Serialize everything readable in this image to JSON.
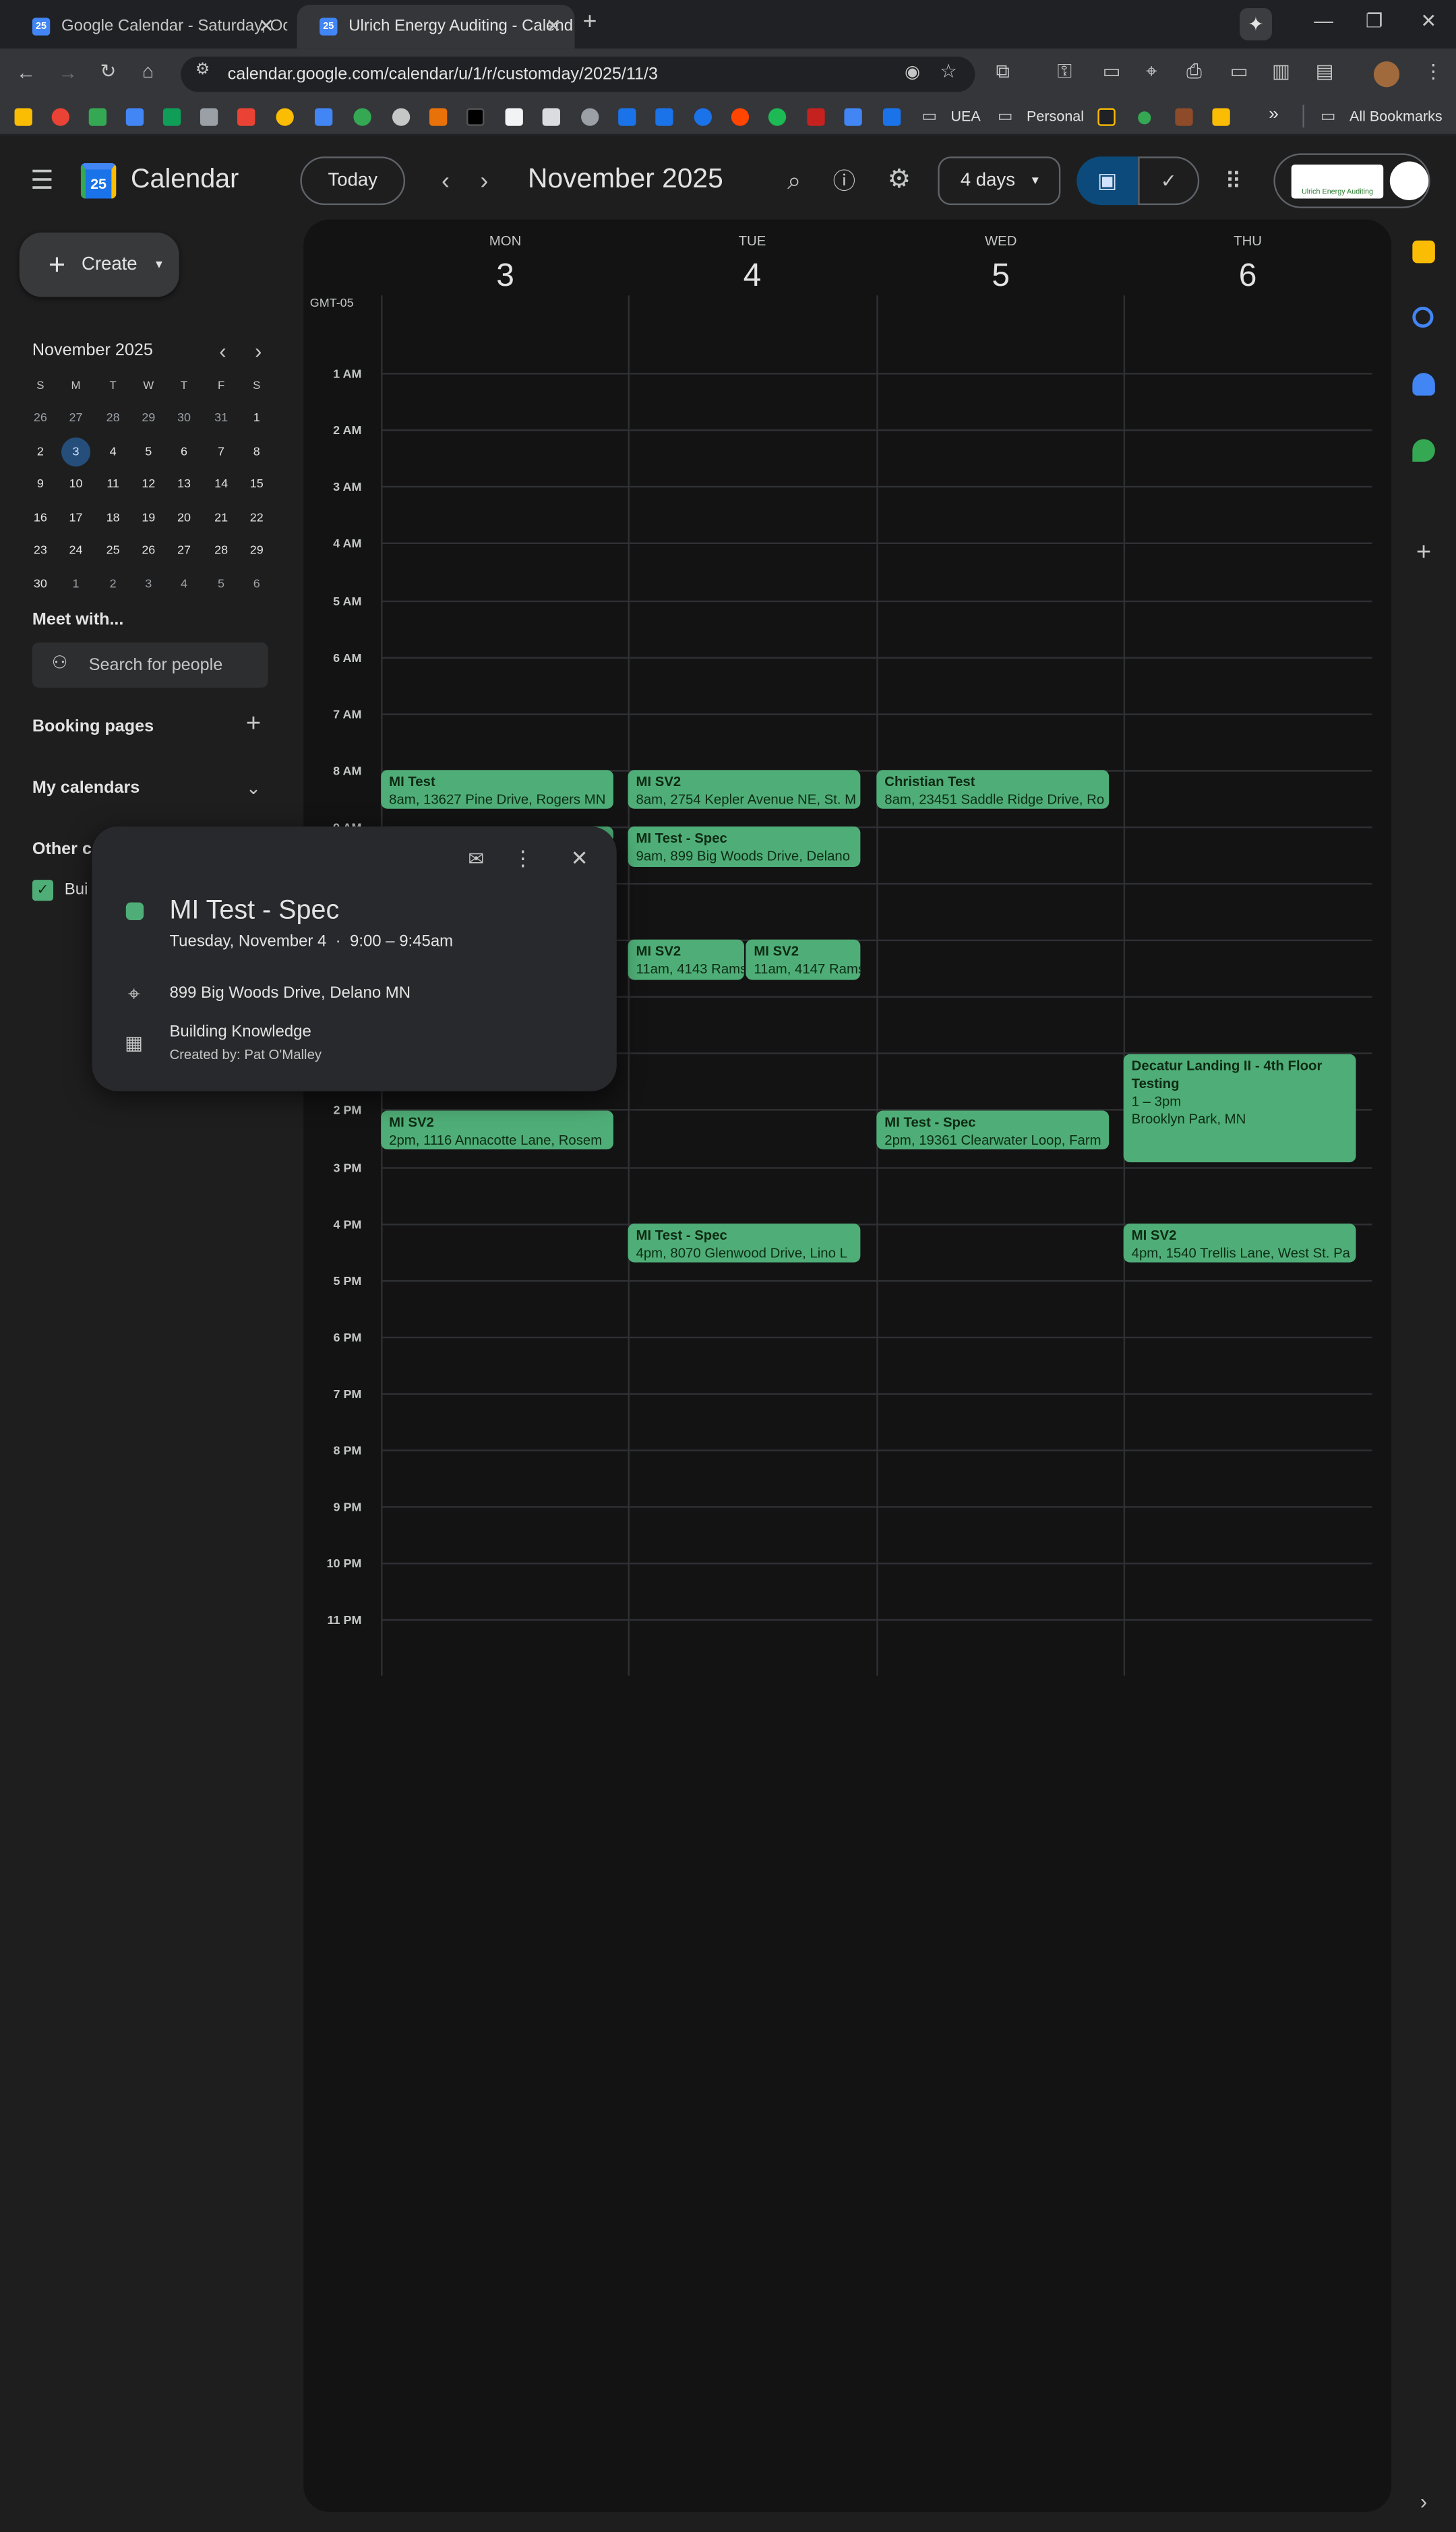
{
  "browser": {
    "tabs": [
      {
        "title": "Google Calendar - Saturday, Oc",
        "active": false
      },
      {
        "title": "Ulrich Energy Auditing - Calend",
        "active": true
      }
    ],
    "url": "calendar.google.com/calendar/u/1/r/customday/2025/11/3",
    "bookmarks": {
      "folder1": "UEA",
      "folder2": "Personal",
      "more": "»",
      "all": "All Bookmarks"
    }
  },
  "header": {
    "app_name": "Calendar",
    "logo_day": "25",
    "today_label": "Today",
    "period": "November 2025",
    "view_label": "4 days",
    "account_label": "Ulrich Energy Auditing"
  },
  "sidebar": {
    "create_label": "Create",
    "mini_month": "November 2025",
    "dow": [
      "S",
      "M",
      "T",
      "W",
      "T",
      "F",
      "S"
    ],
    "weeks": [
      [
        "26",
        "27",
        "28",
        "29",
        "30",
        "31",
        "1"
      ],
      [
        "2",
        "3",
        "4",
        "5",
        "6",
        "7",
        "8"
      ],
      [
        "9",
        "10",
        "11",
        "12",
        "13",
        "14",
        "15"
      ],
      [
        "16",
        "17",
        "18",
        "19",
        "20",
        "21",
        "22"
      ],
      [
        "23",
        "24",
        "25",
        "26",
        "27",
        "28",
        "29"
      ],
      [
        "30",
        "1",
        "2",
        "3",
        "4",
        "5",
        "6"
      ]
    ],
    "selected_day": "3",
    "meet_with": "Meet with...",
    "search_people": "Search for people",
    "booking_pages": "Booking pages",
    "my_calendars": "My calendars",
    "other_calendars": "Other c",
    "other_item": "Bui"
  },
  "grid": {
    "timezone": "GMT-05",
    "days": [
      {
        "dow": "MON",
        "num": "3"
      },
      {
        "dow": "TUE",
        "num": "4"
      },
      {
        "dow": "WED",
        "num": "5"
      },
      {
        "dow": "THU",
        "num": "6"
      }
    ],
    "hours": [
      "1 AM",
      "2 AM",
      "3 AM",
      "4 AM",
      "5 AM",
      "6 AM",
      "7 AM",
      "8 AM",
      "9 AM",
      "10 AM",
      "11 AM",
      "12 PM",
      "1 PM",
      "2 PM",
      "3 PM",
      "4 PM",
      "5 PM",
      "6 PM",
      "7 PM",
      "8 PM",
      "9 PM",
      "10 PM",
      "11 PM"
    ]
  },
  "events": [
    {
      "title": "MI Test",
      "detail": "8am, 13627 Pine Drive, Rogers MN"
    },
    {
      "title": "MI SV2",
      "detail": "8am, 2754 Kepler Avenue NE, St. M"
    },
    {
      "title": "Christian Test",
      "detail": "8am, 23451 Saddle Ridge Drive, Ro"
    },
    {
      "title": "MI Test - Spec",
      "detail": "9am, 899 Big Woods Drive, Delano"
    },
    {
      "title": "MI SV2",
      "detail": "11am, 4143 Rams"
    },
    {
      "title": "MI SV2",
      "detail": "11am, 4147 Rams"
    },
    {
      "title": "Decatur Landing II - 4th Floor Testing",
      "detail": "1 – 3pm",
      "location": "Brooklyn Park, MN"
    },
    {
      "title": "MI SV2",
      "detail": "2pm, 1116 Annacotte Lane, Rosem"
    },
    {
      "title": "MI Test - Spec",
      "detail": "2pm, 19361 Clearwater Loop, Farm"
    },
    {
      "title": "MI Test - Spec",
      "detail": "4pm, 8070 Glenwood Drive, Lino L"
    },
    {
      "title": "MI SV2",
      "detail": "4pm, 1540 Trellis Lane, West St. Pa"
    }
  ],
  "popup": {
    "title": "MI Test - Spec",
    "date": "Tuesday, November 4",
    "dot": "·",
    "time": "9:00 – 9:45am",
    "location": "899 Big Woods Drive, Delano MN",
    "calendar": "Building Knowledge",
    "created_by": "Created by: Pat O'Malley"
  },
  "colors": {
    "event": "#4fae77",
    "panel": "#131314",
    "accent": "#0b57d0"
  }
}
